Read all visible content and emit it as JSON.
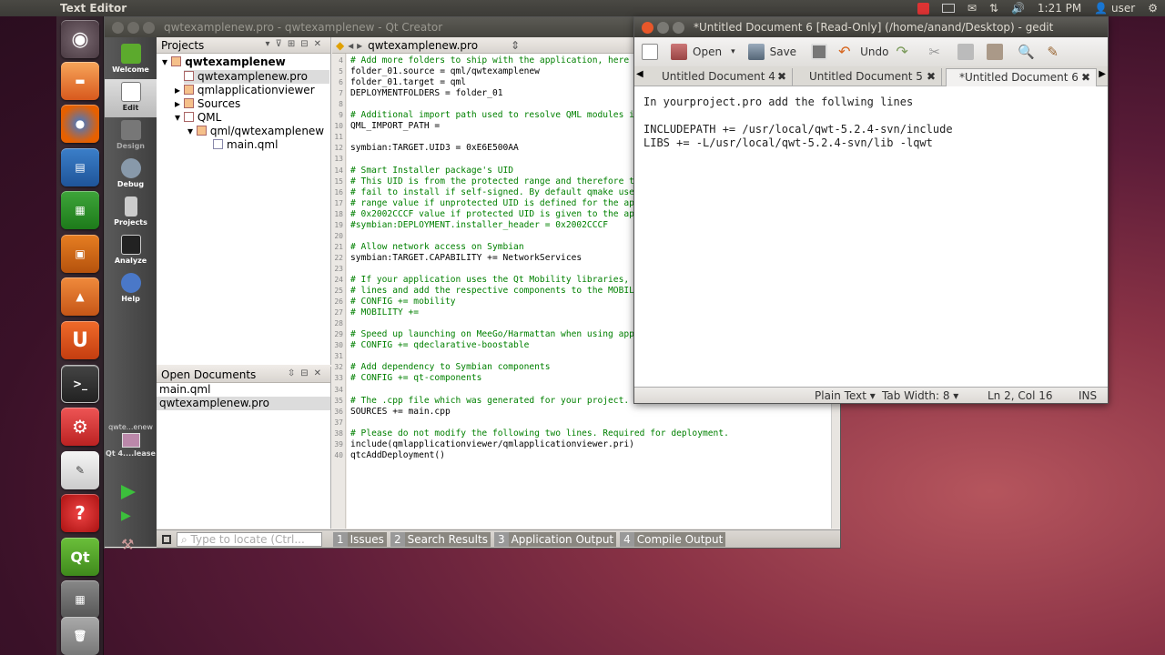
{
  "topbar": {
    "app_title": "Text Editor",
    "time": "1:21 PM",
    "user": "user"
  },
  "qtcreator": {
    "title": "qwtexamplenew.pro - qwtexamplenew - Qt Creator",
    "modes": [
      "Welcome",
      "Edit",
      "Design",
      "Debug",
      "Projects",
      "Analyze",
      "Help"
    ],
    "kit_label": "qwte...enew",
    "kit_build": "Qt 4....lease",
    "projects_header": "Projects",
    "tree": [
      "qwtexamplenew",
      "qwtexamplenew.pro",
      "qmlapplicationviewer",
      "Sources",
      "QML",
      "qml/qwtexamplenew",
      "main.qml"
    ],
    "open_docs_header": "Open Documents",
    "open_docs": [
      "main.qml",
      "qwtexamplenew.pro"
    ],
    "editor_file": "qwtexamplenew.pro",
    "code": [
      {
        "n": "4",
        "t": "# Add more folders to ship with the application, here",
        "c": "cm"
      },
      {
        "n": "5",
        "t": "folder_01.source = qml/qwtexamplenew",
        "c": "pl"
      },
      {
        "n": "6",
        "t": "folder_01.target = qml",
        "c": "pl"
      },
      {
        "n": "7",
        "t": "DEPLOYMENTFOLDERS = folder_01",
        "c": "pl"
      },
      {
        "n": "8",
        "t": "",
        "c": "pl"
      },
      {
        "n": "9",
        "t": "# Additional import path used to resolve QML modules i",
        "c": "cm"
      },
      {
        "n": "10",
        "t": "QML_IMPORT_PATH =",
        "c": "pl"
      },
      {
        "n": "11",
        "t": "",
        "c": "pl"
      },
      {
        "n": "12",
        "t": "symbian:TARGET.UID3 = 0xE6E500AA",
        "c": "pl"
      },
      {
        "n": "13",
        "t": "",
        "c": "pl"
      },
      {
        "n": "14",
        "t": "# Smart Installer package's UID",
        "c": "cm"
      },
      {
        "n": "15",
        "t": "# This UID is from the protected range and therefore t",
        "c": "cm"
      },
      {
        "n": "16",
        "t": "# fail to install if self-signed. By default qmake use",
        "c": "cm"
      },
      {
        "n": "17",
        "t": "# range value if unprotected UID is defined for the ap",
        "c": "cm"
      },
      {
        "n": "18",
        "t": "# 0x2002CCCF value if protected UID is given to the ap",
        "c": "cm"
      },
      {
        "n": "19",
        "t": "#symbian:DEPLOYMENT.installer_header = 0x2002CCCF",
        "c": "cm"
      },
      {
        "n": "20",
        "t": "",
        "c": "pl"
      },
      {
        "n": "21",
        "t": "# Allow network access on Symbian",
        "c": "cm"
      },
      {
        "n": "22",
        "t": "symbian:TARGET.CAPABILITY += NetworkServices",
        "c": "pl"
      },
      {
        "n": "23",
        "t": "",
        "c": "pl"
      },
      {
        "n": "24",
        "t": "# If your application uses the Qt Mobility libraries,",
        "c": "cm"
      },
      {
        "n": "25",
        "t": "# lines and add the respective components to the MOBIL",
        "c": "cm"
      },
      {
        "n": "26",
        "t": "# CONFIG += mobility",
        "c": "cm"
      },
      {
        "n": "27",
        "t": "# MOBILITY +=",
        "c": "cm"
      },
      {
        "n": "28",
        "t": "",
        "c": "pl"
      },
      {
        "n": "29",
        "t": "# Speed up launching on MeeGo/Harmattan when using app",
        "c": "cm"
      },
      {
        "n": "30",
        "t": "# CONFIG += qdeclarative-boostable",
        "c": "cm"
      },
      {
        "n": "31",
        "t": "",
        "c": "pl"
      },
      {
        "n": "32",
        "t": "# Add dependency to Symbian components",
        "c": "cm"
      },
      {
        "n": "33",
        "t": "# CONFIG += qt-components",
        "c": "cm"
      },
      {
        "n": "34",
        "t": "",
        "c": "pl"
      },
      {
        "n": "35",
        "t": "# The .cpp file which was generated for your project. Feel free to hack it.",
        "c": "cm"
      },
      {
        "n": "36",
        "t": "SOURCES += main.cpp",
        "c": "pl"
      },
      {
        "n": "37",
        "t": "",
        "c": "pl"
      },
      {
        "n": "38",
        "t": "# Please do not modify the following two lines. Required for deployment.",
        "c": "cm"
      },
      {
        "n": "39",
        "t": "include(qmlapplicationviewer/qmlapplicationviewer.pri)",
        "c": "pl"
      },
      {
        "n": "40",
        "t": "qtcAddDeployment()",
        "c": "pl"
      }
    ],
    "locator_placeholder": "Type to locate (Ctrl...",
    "output_tabs": [
      {
        "n": "1",
        "l": "Issues"
      },
      {
        "n": "2",
        "l": "Search Results"
      },
      {
        "n": "3",
        "l": "Application Output"
      },
      {
        "n": "4",
        "l": "Compile Output"
      }
    ]
  },
  "gedit": {
    "title": "*Untitled Document 6 [Read-Only] (/home/anand/Desktop) - gedit",
    "toolbar": {
      "open": "Open",
      "save": "Save",
      "undo": "Undo"
    },
    "tabs": [
      "Untitled Document 4",
      "Untitled Document 5",
      "*Untitled Document 6"
    ],
    "lines": [
      "In yourproject.pro add the follwing lines",
      "",
      "INCLUDEPATH += /usr/local/qwt-5.2.4-svn/include",
      "LIBS += -L/usr/local/qwt-5.2.4-svn/lib -lqwt"
    ],
    "status": {
      "lang": "Plain Text",
      "tab": "Tab Width: 8",
      "pos": "Ln 2, Col 16",
      "mode": "INS"
    }
  }
}
